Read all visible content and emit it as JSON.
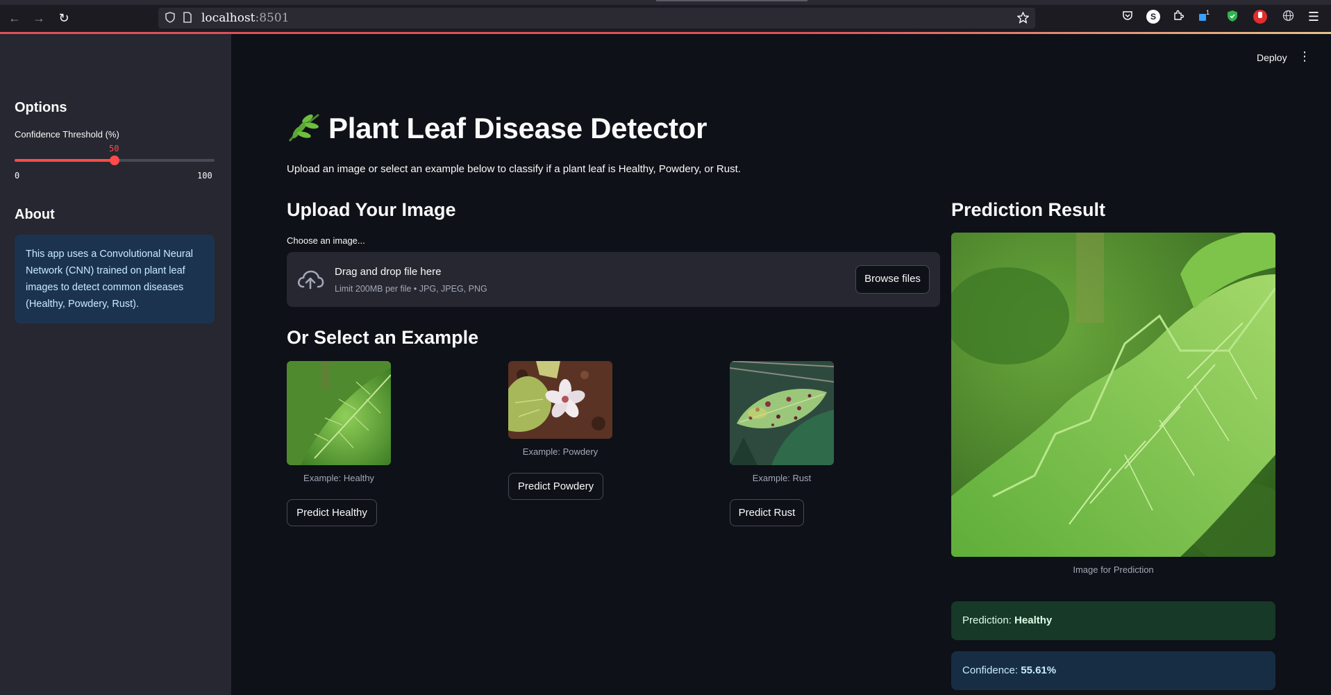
{
  "browser": {
    "url_host": "localhost",
    "url_port": ":8501",
    "extension_badge": "1"
  },
  "header": {
    "deploy_label": "Deploy"
  },
  "sidebar": {
    "options_heading": "Options",
    "slider": {
      "label": "Confidence Threshold (%)",
      "value": "50",
      "min": "0",
      "max": "100",
      "fraction": 0.5
    },
    "about_heading": "About",
    "about_text": "This app uses a Convolutional Neural Network (CNN) trained on plant leaf images to detect common diseases (Healthy, Powdery, Rust)."
  },
  "main": {
    "title_emoji": "🌿",
    "title": "Plant Leaf Disease Detector",
    "subtitle": "Upload an image or select an example below to classify if a plant leaf is Healthy, Powdery, or Rust.",
    "upload_heading": "Upload Your Image",
    "uploader": {
      "label": "Choose an image...",
      "drop_text": "Drag and drop file here",
      "limit_text": "Limit 200MB per file • JPG, JPEG, PNG",
      "browse_label": "Browse files"
    },
    "examples_heading": "Or Select an Example",
    "examples": [
      {
        "caption": "Example: Healthy",
        "button": "Predict Healthy"
      },
      {
        "caption": "Example: Powdery",
        "button": "Predict Powdery"
      },
      {
        "caption": "Example: Rust",
        "button": "Predict Rust"
      }
    ],
    "result_heading": "Prediction Result",
    "result_caption": "Image for Prediction",
    "prediction_label": "Prediction:",
    "prediction_value": "Healthy",
    "confidence_label": "Confidence:",
    "confidence_value": "55.61%"
  },
  "colors": {
    "accent": "#ff4b4b",
    "background": "#0e1117",
    "sidebar": "#262730",
    "success_bg": "#173928",
    "info_bg": "#172d43"
  }
}
